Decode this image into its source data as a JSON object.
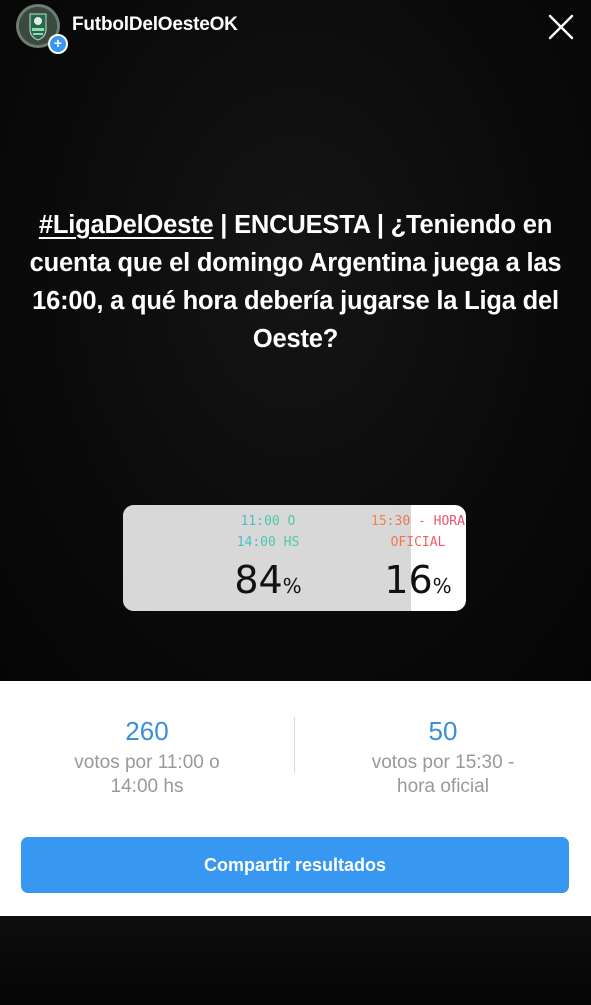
{
  "header": {
    "username": "FutbolDelOesteOK",
    "avatar_icon": "club-shield-logo",
    "plus_badge": "+",
    "close_icon": "close-x-icon"
  },
  "story": {
    "hashtag": "#LigaDelOeste",
    "question_rest": " | ENCUESTA | ¿Teniendo en cuenta que el domingo Argentina juega a las 16:00, a qué hora debería jugarse la Liga del Oeste?"
  },
  "poll": {
    "options": [
      {
        "label_line1": "11:00 O",
        "label_line2": "14:00 HS",
        "percent": "84",
        "percent_sign": "%",
        "fraction": 0.84
      },
      {
        "label_line1": "15:30 - HORA",
        "label_line2": "OFICIAL",
        "percent": "16",
        "percent_sign": "%",
        "fraction": 0.16
      }
    ]
  },
  "results": {
    "left": {
      "count": "260",
      "label_line1": "votos por 11:00 o",
      "label_line2": "14:00 hs"
    },
    "right": {
      "count": "50",
      "label_line1": "votos por 15:30 -",
      "label_line2": "hora oficial"
    },
    "share_label": "Compartir resultados"
  },
  "colors": {
    "accent": "#3897f0",
    "count_blue": "#3b8fd9",
    "option1_gradient": [
      "#3fb6e8",
      "#55d27b"
    ],
    "option2_gradient": [
      "#f58b3b",
      "#e6457a"
    ]
  }
}
